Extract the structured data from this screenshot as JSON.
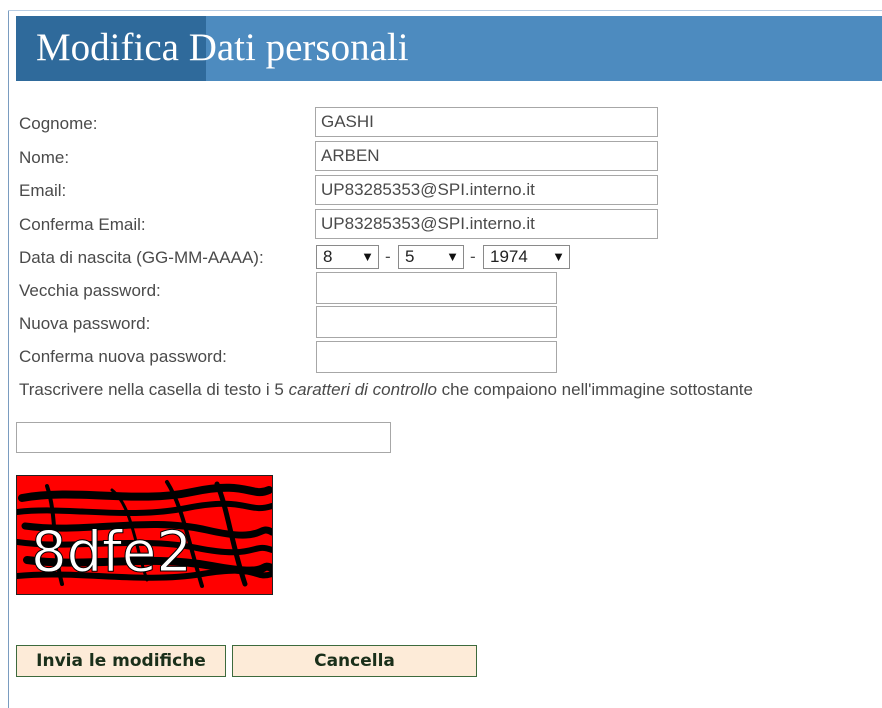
{
  "header": {
    "title": "Modifica Dati personali"
  },
  "form": {
    "cognome": {
      "label": "Cognome:",
      "value": "GASHI"
    },
    "nome": {
      "label": "Nome:",
      "value": "ARBEN"
    },
    "email": {
      "label": "Email:",
      "value": "UP83285353@SPI.interno.it"
    },
    "conferma_email": {
      "label": "Conferma Email:",
      "value": "UP83285353@SPI.interno.it"
    },
    "data_nascita": {
      "label": "Data di nascita (GG-MM-AAAA):",
      "day": "8",
      "month": "5",
      "year": "1974",
      "separator": "-",
      "arrow": "▼"
    },
    "vecchia_password": {
      "label": "Vecchia password:",
      "value": ""
    },
    "nuova_password": {
      "label": "Nuova password:",
      "value": ""
    },
    "conferma_password": {
      "label": "Conferma nuova password:",
      "value": ""
    },
    "captcha_instruction": {
      "before": "Trascrivere nella casella di testo i 5 ",
      "emphasis": "caratteri di controllo",
      "after": " che compaiono nell'immagine sottostante"
    },
    "captcha_input": {
      "value": ""
    },
    "captcha_image": {
      "text": "8dfe2",
      "background": "#ff0000"
    }
  },
  "buttons": {
    "submit": "Invia le modifiche",
    "cancel": "Cancella"
  },
  "colors": {
    "header_bg": "#4d8bbf",
    "header_dark": "#2f6a9b",
    "button_bg": "#fdebd8",
    "button_border": "#3d6a3d"
  }
}
